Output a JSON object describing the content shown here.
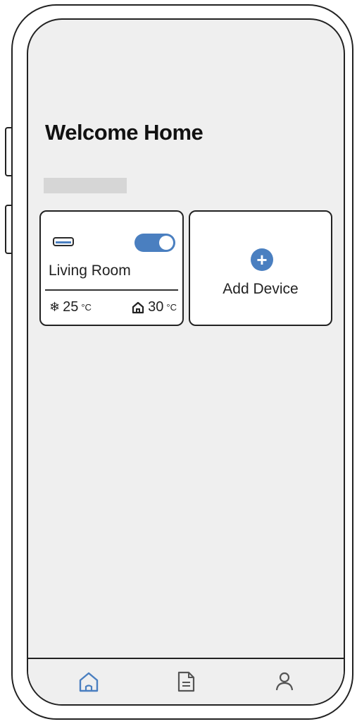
{
  "header": {
    "title": "Welcome Home"
  },
  "devices": [
    {
      "icon": "air-conditioner-icon",
      "name": "Living Room",
      "power_on": true,
      "set_temp": "25",
      "set_temp_unit": "°C",
      "indoor_temp": "30",
      "indoor_temp_unit": "°C"
    }
  ],
  "add_device": {
    "label": "Add Device",
    "icon": "plus-icon"
  },
  "tabbar": {
    "items": [
      {
        "icon": "home-icon",
        "active": true
      },
      {
        "icon": "document-icon",
        "active": false
      },
      {
        "icon": "user-icon",
        "active": false
      }
    ]
  },
  "colors": {
    "accent": "#4a7fc0",
    "screen_bg": "#efefef",
    "card_bg": "#ffffff",
    "outline": "#222222"
  }
}
